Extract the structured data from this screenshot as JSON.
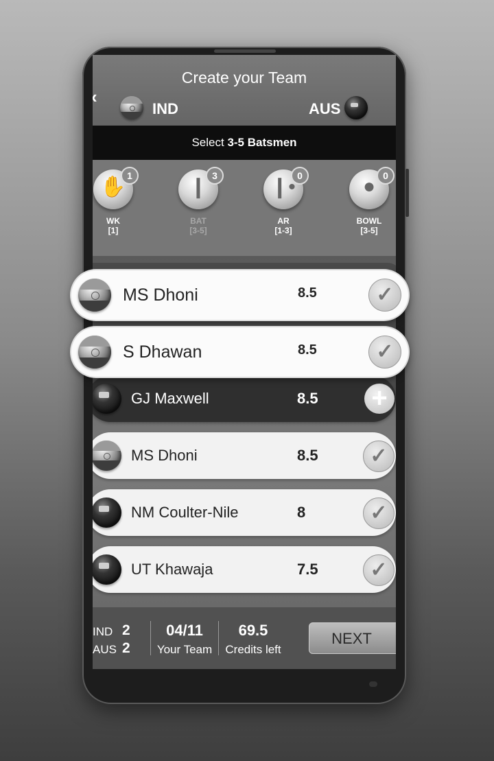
{
  "header": {
    "title": "Create your Team",
    "back_icon": "back-chevron-icon",
    "team_left": "IND",
    "team_right": "AUS"
  },
  "select_bar": {
    "prefix": "Select ",
    "range": "3-5 Batsmen"
  },
  "roles": [
    {
      "label": "WK",
      "range": "[1]",
      "count": "1",
      "icon": "wicket-keeper-gloves-icon"
    },
    {
      "label": "BAT",
      "range": "[3-5]",
      "count": "3",
      "icon": "cricket-bat-icon"
    },
    {
      "label": "AR",
      "range": "[1-3]",
      "count": "0",
      "icon": "bat-and-ball-icon"
    },
    {
      "label": "BOWL",
      "range": "[3-5]",
      "count": "0",
      "icon": "cricket-ball-icon"
    }
  ],
  "highlighted_players": [
    {
      "name": "MS Dhoni",
      "credits": "8.5",
      "team": "IND",
      "selected": true
    },
    {
      "name": "S Dhawan",
      "credits": "8.5",
      "team": "IND",
      "selected": true
    }
  ],
  "players": [
    {
      "name": "GJ Maxwell",
      "credits": "8.5",
      "team": "AUS",
      "selected": false
    },
    {
      "name": "MS Dhoni",
      "credits": "8.5",
      "team": "IND",
      "selected": true
    },
    {
      "name": "NM Coulter-Nile",
      "credits": "8",
      "team": "AUS",
      "selected": true
    },
    {
      "name": "UT Khawaja",
      "credits": "7.5",
      "team": "AUS",
      "selected": true
    }
  ],
  "footer": {
    "ind_label": "IND",
    "ind_count": "2",
    "aus_label": "AUS",
    "aus_count": "2",
    "team_count": "04/11",
    "team_label": "Your Team",
    "credits_left": "69.5",
    "credits_label": "Credits left",
    "next_label": "NEXT"
  }
}
